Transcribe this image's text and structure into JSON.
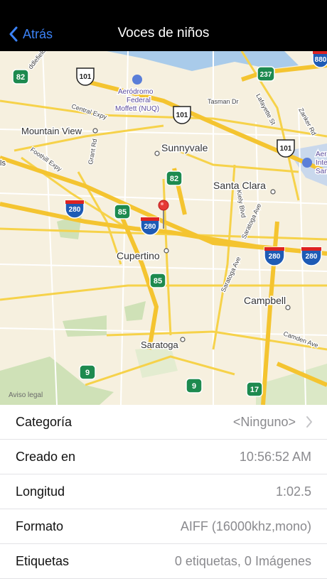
{
  "navbar": {
    "back_label": "Atrás",
    "title": "Voces de niños"
  },
  "map": {
    "legal": "Aviso legal",
    "place_labels": {
      "mountain_view": "Mountain View",
      "sunnyvale": "Sunnyvale",
      "santa_clara": "Santa Clara",
      "cupertino": "Cupertino",
      "campbell": "Campbell",
      "saratoga": "Saratoga",
      "airport_line1": "Aeródromo",
      "airport_line2": "Federal",
      "airport_line3": "Moffett (NUQ)",
      "airport2_line1": "Aer",
      "airport2_line2": "Inte",
      "airport2_line3": "San",
      "ls": "ls"
    },
    "road_labels": {
      "central_expy": "Central Expy",
      "foothill_expy": "Foothill Expy",
      "grant_rd": "Grant Rd",
      "tasman_dr": "Tasman Dr",
      "lafayette_st": "Lafayette St",
      "zanker_rd": "Zanker Rd",
      "kiely_blvd": "Kiely Blvd",
      "saratoga_ave1": "Saratoga Ave",
      "saratoga_ave2": "Saratoga Ave",
      "camden_ave": "Camden Ave",
      "middlefield": "ddlefield Rd"
    },
    "shields": {
      "s82a": "82",
      "s101a": "101",
      "s237": "237",
      "s880": "880",
      "s101b": "101",
      "s101c": "101",
      "s82b": "82",
      "s85a": "85",
      "s280a": "280",
      "s280b": "280",
      "s280c": "280",
      "s280d": "280",
      "s85b": "85",
      "s9a": "9",
      "s9b": "9",
      "s17": "17"
    }
  },
  "details": [
    {
      "label": "Categoría",
      "value": "<Ninguno>"
    },
    {
      "label": "Creado en",
      "value": "10:56:52 AM"
    },
    {
      "label": "Longitud",
      "value": "1:02.5"
    },
    {
      "label": "Formato",
      "value": "AIFF (16000khz,mono)"
    },
    {
      "label": "Etiquetas",
      "value": "0 etiquetas, 0 Imágenes"
    }
  ]
}
